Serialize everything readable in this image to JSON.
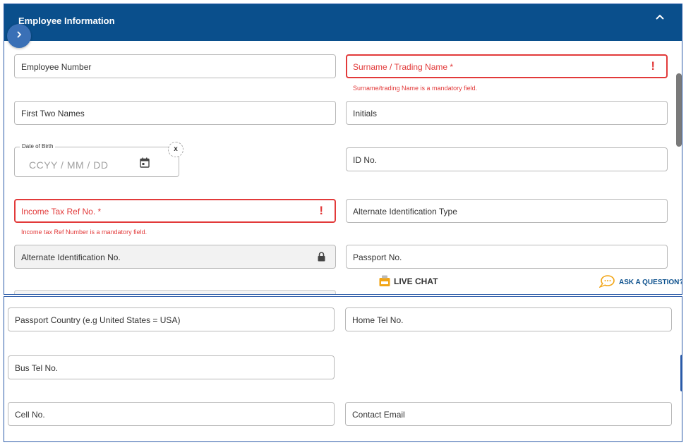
{
  "section": {
    "title": "Employee Information",
    "collapse_icon": "chevron-up-icon",
    "sidebar_toggle_icon": "chevron-right-icon"
  },
  "fields": {
    "employee_number": {
      "label": "Employee Number"
    },
    "surname": {
      "label": "Surname / Trading Name *",
      "error": "Surname/trading Name is a mandatory field."
    },
    "first_two_names": {
      "label": "First Two Names"
    },
    "initials": {
      "label": "Initials"
    },
    "date_of_birth": {
      "legend": "Date of Birth",
      "placeholder": "CCYY / MM / DD",
      "clear_label": "x"
    },
    "id_no": {
      "label": "ID No."
    },
    "income_tax_ref": {
      "label": "Income Tax Ref No. *",
      "error": "Income tax Ref Number is a mandatory field."
    },
    "alternate_id_type": {
      "label": "Alternate Identification Type"
    },
    "alternate_id_no": {
      "label": "Alternate Identification No."
    },
    "passport_no": {
      "label": "Passport No."
    },
    "passport_country": {
      "label": "Passport Country (e.g United States = USA)"
    },
    "home_tel": {
      "label": "Home Tel No."
    },
    "bus_tel": {
      "label": "Bus Tel No."
    },
    "cell_no": {
      "label": "Cell No."
    },
    "contact_email": {
      "label": "Contact Email"
    }
  },
  "error_mark": "!",
  "support": {
    "live_chat_label": "LIVE CHAT",
    "ask_question_label": "ASK A QUESTION?"
  },
  "colors": {
    "header_bg": "#0a4f8c",
    "error": "#e23a3a",
    "panel_border": "#2a5aa8"
  }
}
